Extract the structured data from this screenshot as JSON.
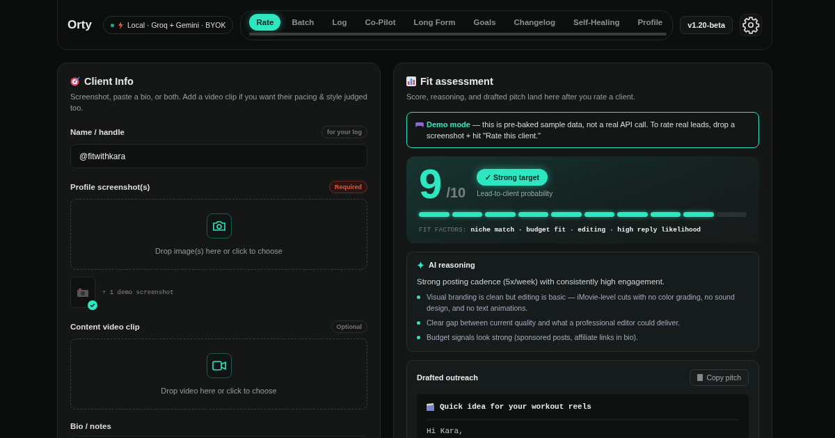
{
  "header": {
    "brand": "Orty",
    "status": {
      "text": "Local · Groq + Gemini · BYOK",
      "online": true
    },
    "tabs": [
      {
        "label": "Rate",
        "selected": true
      },
      {
        "label": "Batch",
        "selected": false
      },
      {
        "label": "Log",
        "selected": false
      },
      {
        "label": "Co-Pilot",
        "selected": false
      },
      {
        "label": "Long Form",
        "selected": false
      },
      {
        "label": "Goals",
        "selected": false
      },
      {
        "label": "Changelog",
        "selected": false
      },
      {
        "label": "Self-Healing",
        "selected": false
      },
      {
        "label": "Profile",
        "selected": false
      }
    ],
    "version": "v1.20-beta"
  },
  "client_info": {
    "title": "Client Info",
    "description": "Screenshot, paste a bio, or both. Add a video clip if you want their pacing & style judged too.",
    "fields": [
      {
        "kind": "input",
        "label": "Name / handle",
        "tag": "for your log",
        "required": false,
        "value": "@fitwithkara"
      },
      {
        "kind": "image_drop",
        "label": "Profile screenshot(s)",
        "tag": "Required",
        "required": true,
        "hint": "Drop image(s) here or click to choose",
        "attachment": "+ 1 demo screenshot"
      },
      {
        "kind": "video_drop",
        "label": "Content video clip",
        "tag": "Optional",
        "required": false,
        "hint": "Drop video here or click to choose"
      },
      {
        "kind": "textarea",
        "label": "Bio / notes"
      }
    ]
  },
  "fit": {
    "title": "Fit assessment",
    "description": "Score, reasoning, and drafted pitch land here after you rate a client.",
    "banner": "**Demo mode** — this is pre-baked sample data, not a real API call. To rate real leads, drop a screenshot + hit \"Rate this client.\"",
    "score": "9",
    "score_max": "/10",
    "verdict": "✓ Strong target",
    "verdict_caption": "Lead-to-client probability",
    "level": 0.9,
    "factors_label": "FIT FACTORS:",
    "factors": "niche match · budget fit · editing · high reply likelihood",
    "reasoning": {
      "title": "AI reasoning",
      "summary": "Strong posting cadence (5x/week) with consistently high engagement.",
      "points": [
        "Visual branding is clean but editing is basic — iMovie-level cuts with no color grading, no sound design, and no text animations.",
        "Clear gap between current quality and what a professional editor could deliver.",
        "Budget signals look strong (sponsored posts, affiliate links in bio)."
      ]
    },
    "outreach": {
      "title": "Drafted outreach",
      "copy_button": "Copy pitch",
      "subject": "Quick idea for your workout reels",
      "body": "Hi Kara,"
    }
  }
}
